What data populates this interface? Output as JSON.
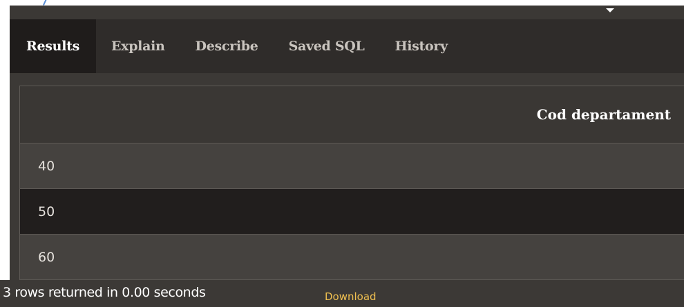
{
  "tabs": [
    {
      "label": "Results",
      "active": true
    },
    {
      "label": "Explain",
      "active": false
    },
    {
      "label": "Describe",
      "active": false
    },
    {
      "label": "Saved SQL",
      "active": false
    },
    {
      "label": "History",
      "active": false
    }
  ],
  "results": {
    "column_header": "Cod departament",
    "rows": [
      {
        "value": "40"
      },
      {
        "value": "50"
      },
      {
        "value": "60"
      }
    ]
  },
  "footer": {
    "status_text": "3 rows returned in 0.00 seconds",
    "download_label": "Download"
  },
  "colors": {
    "accent_link": "#f0c050",
    "active_tab_bg": "#1f1c1b",
    "tab_bar_bg": "#2f2c2a"
  },
  "icons": {
    "dropdown": "caret-down-icon"
  }
}
